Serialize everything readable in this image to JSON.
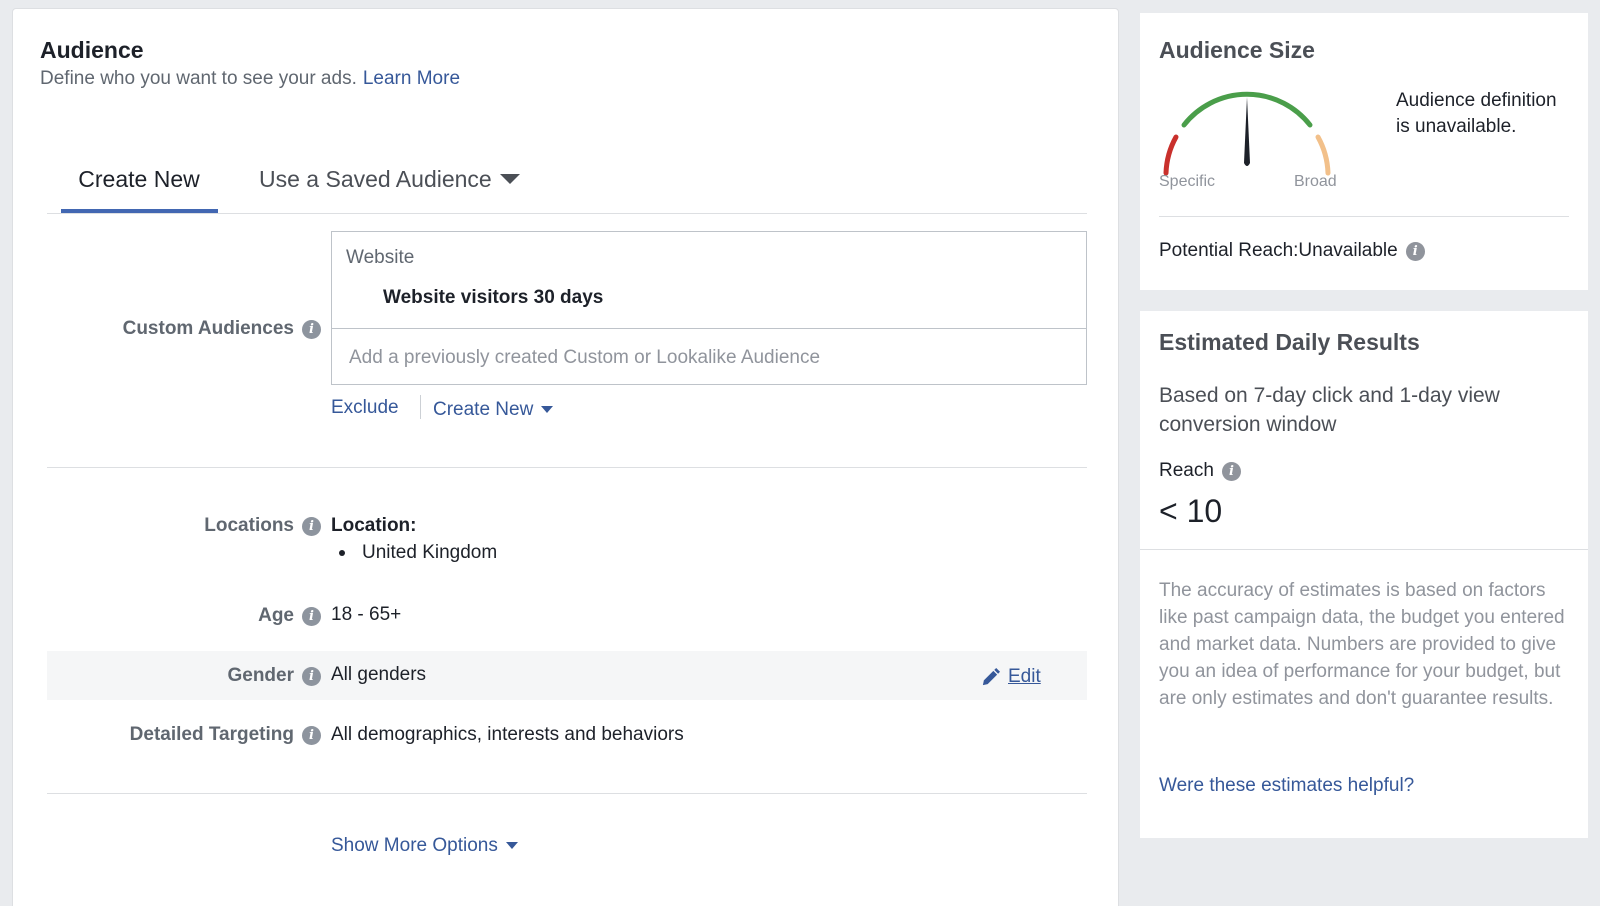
{
  "audience": {
    "title": "Audience",
    "subtitle": "Define who you want to see your ads.",
    "learn_more": "Learn More",
    "tabs": {
      "create_new": "Create New",
      "saved": "Use a Saved Audience"
    },
    "custom_audiences": {
      "label": "Custom Audiences",
      "category": "Website",
      "selected": "Website visitors 30 days",
      "placeholder": "Add a previously created Custom or Lookalike Audience",
      "exclude": "Exclude",
      "create_new": "Create New"
    },
    "locations": {
      "label": "Locations",
      "heading": "Location:",
      "items": [
        "United Kingdom"
      ]
    },
    "age": {
      "label": "Age",
      "value": "18 - 65+"
    },
    "gender": {
      "label": "Gender",
      "value": "All genders",
      "edit": "Edit"
    },
    "detailed_targeting": {
      "label": "Detailed Targeting",
      "value": "All demographics, interests and behaviors"
    },
    "show_more": "Show More Options"
  },
  "audience_size": {
    "title": "Audience Size",
    "specific": "Specific",
    "broad": "Broad",
    "description": "Audience definition is unavailable.",
    "potential_reach": "Potential Reach:Unavailable",
    "gauge_colors": {
      "left": "#c9302c",
      "middle": "#4a9e4a",
      "right": "#f2c08a",
      "needle": "#1d2129"
    }
  },
  "estimated_results": {
    "title": "Estimated Daily Results",
    "basis": "Based on 7-day click and 1-day view conversion window",
    "reach_label": "Reach",
    "reach_value": "< 10",
    "accuracy": "The accuracy of estimates is based on factors like past campaign data, the budget you entered and market data. Numbers are provided to give you an idea of performance for your budget, but are only estimates and don't guarantee results.",
    "helpful_link": "Were these estimates helpful?"
  },
  "colors": {
    "link": "#365899",
    "tab_underline": "#4267b2",
    "background": "#e9ebee"
  }
}
